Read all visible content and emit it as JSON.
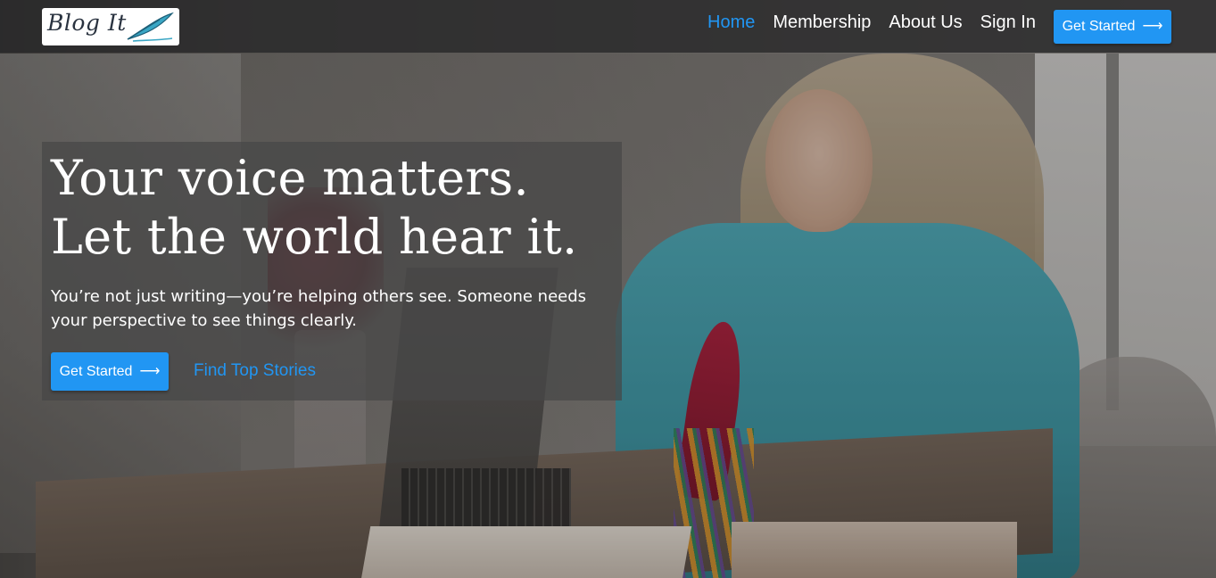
{
  "nav": {
    "logo_text": "Blog It",
    "links": [
      {
        "label": "Home",
        "active": true
      },
      {
        "label": "Membership",
        "active": false
      },
      {
        "label": "About Us",
        "active": false
      },
      {
        "label": "Sign In",
        "active": false
      }
    ],
    "cta_label": "Get Started",
    "cta_icon": "arrow-right-icon"
  },
  "hero": {
    "title_line1": "Your voice matters.",
    "title_line2": "Let the world hear it.",
    "subtitle": "You’re not just writing—you’re helping others see. Someone needs your perspective to see things clearly.",
    "primary_cta_label": "Get Started",
    "secondary_link_label": "Find Top Stories"
  },
  "colors": {
    "accent": "#2196f3",
    "nav_background": "#28282a",
    "text_light": "#ffffff"
  }
}
